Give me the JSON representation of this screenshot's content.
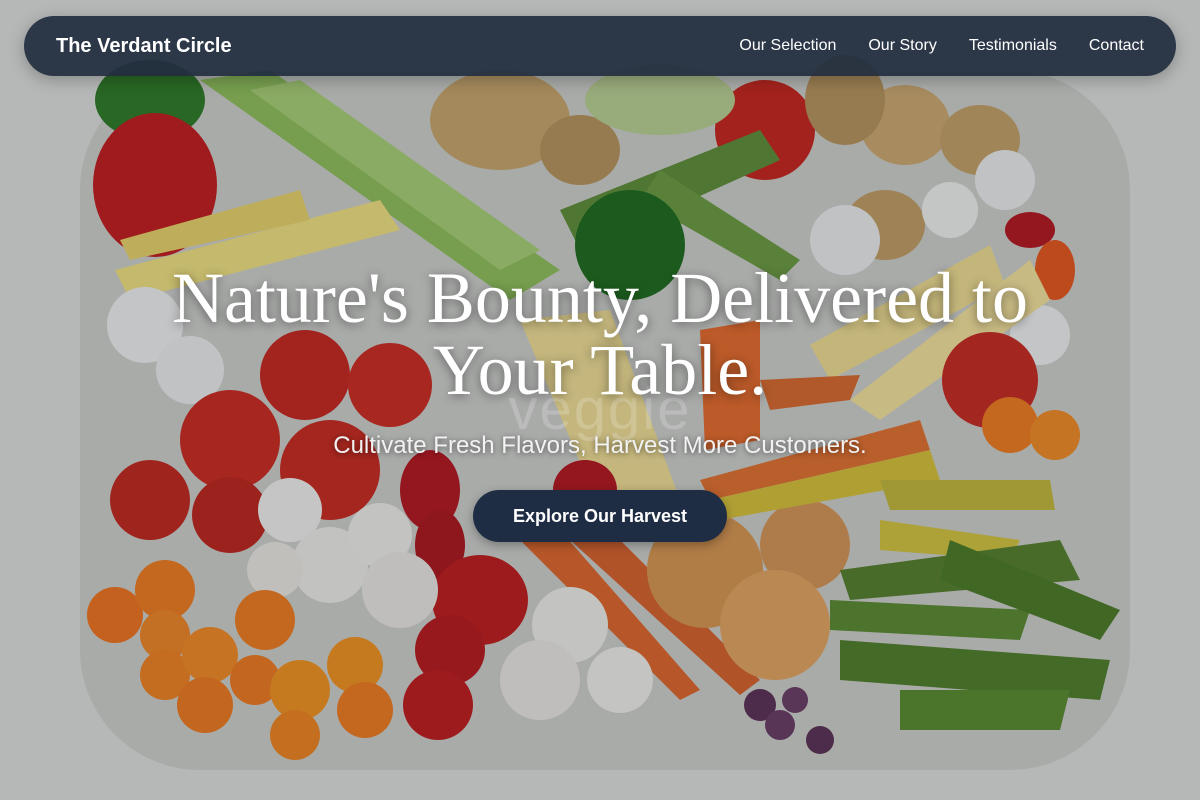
{
  "nav": {
    "brand": "The Verdant Circle",
    "links": [
      "Our Selection",
      "Our Story",
      "Testimonials",
      "Contact"
    ]
  },
  "hero": {
    "headline": "Nature's Bounty, Delivered to Your Table.",
    "watermark": "veggie",
    "subheadline": "Cultivate Fresh Flavors, Harvest More Customers.",
    "cta_label": "Explore Our Harvest"
  },
  "colors": {
    "nav_background": "#212d40",
    "cta_background": "#1f2d44",
    "text": "#ffffff"
  }
}
